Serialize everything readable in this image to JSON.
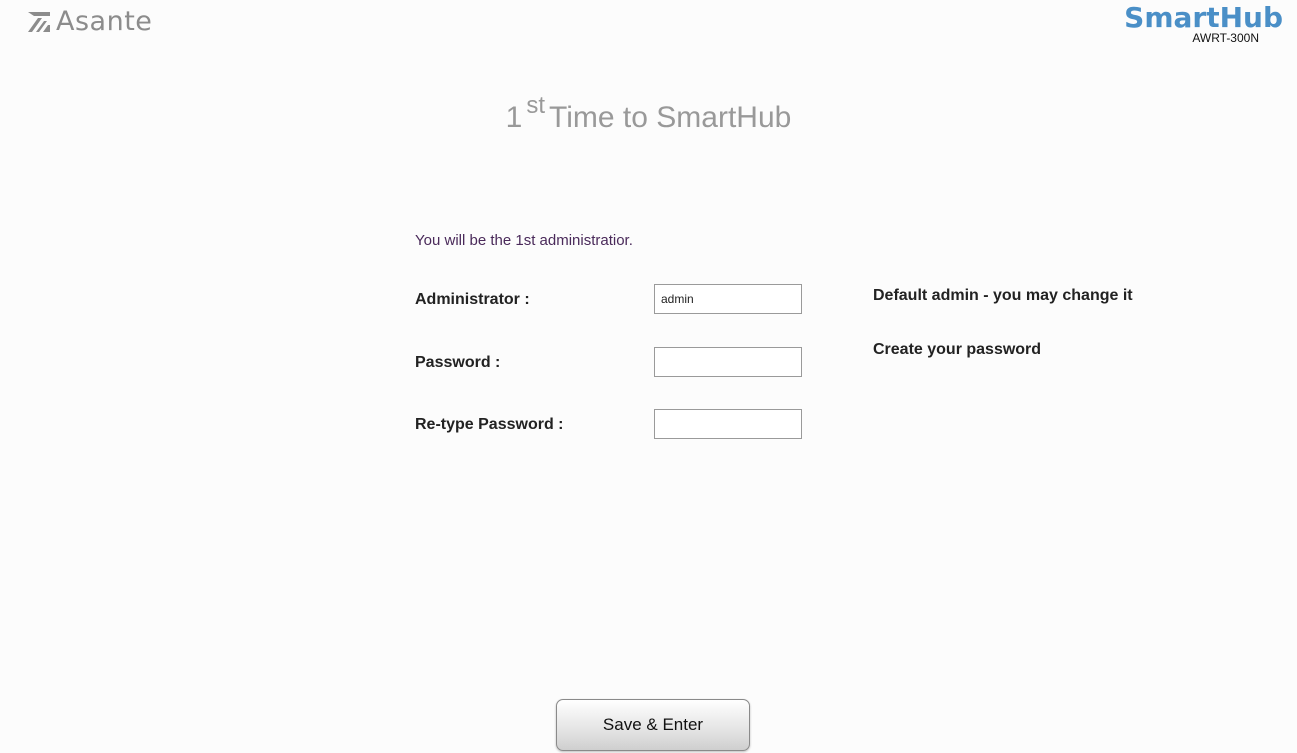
{
  "header": {
    "brand": "Asante",
    "product": "SmartHub",
    "model": "AWRT-300N"
  },
  "title": {
    "number": "1",
    "superscript": "st",
    "text": "Time to SmartHub"
  },
  "intro": "You will be the 1st administratior.",
  "form": {
    "administrator": {
      "label": "Administrator :",
      "value": "admin",
      "hint": "Default admin - you may change it"
    },
    "password": {
      "label": "Password :",
      "value": "",
      "hint": "Create your password"
    },
    "retype_password": {
      "label": "Re-type Password :",
      "value": ""
    }
  },
  "save_button": "Save & Enter",
  "colors": {
    "brand_gray": "#8c8c8c",
    "product_blue": "#4a8fc7",
    "title_gray": "#999999",
    "intro_text": "#4a2a5a"
  },
  "icons": {
    "brand_mark": "asante-logo-icon"
  }
}
